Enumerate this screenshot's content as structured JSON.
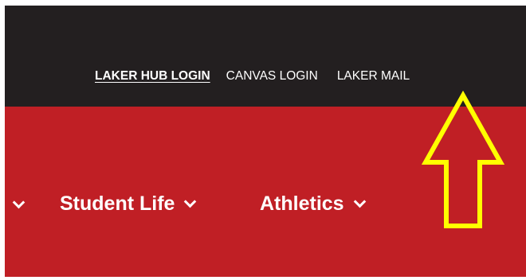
{
  "topbar": {
    "links": [
      {
        "label": "LAKER HUB LOGIN",
        "active": true
      },
      {
        "label": "CANVAS LOGIN",
        "active": false
      },
      {
        "label": "LAKER MAIL",
        "active": false
      }
    ]
  },
  "nav": {
    "items": [
      {
        "label": "Student Life"
      },
      {
        "label": "Athletics"
      }
    ]
  },
  "colors": {
    "topbar_bg": "#231f20",
    "nav_bg": "#c01f25",
    "annotation_arrow": "#ffff00"
  },
  "icons": {
    "nav_dropdown": "chevron-down-icon",
    "annotation": "up-arrow-outline-icon"
  }
}
